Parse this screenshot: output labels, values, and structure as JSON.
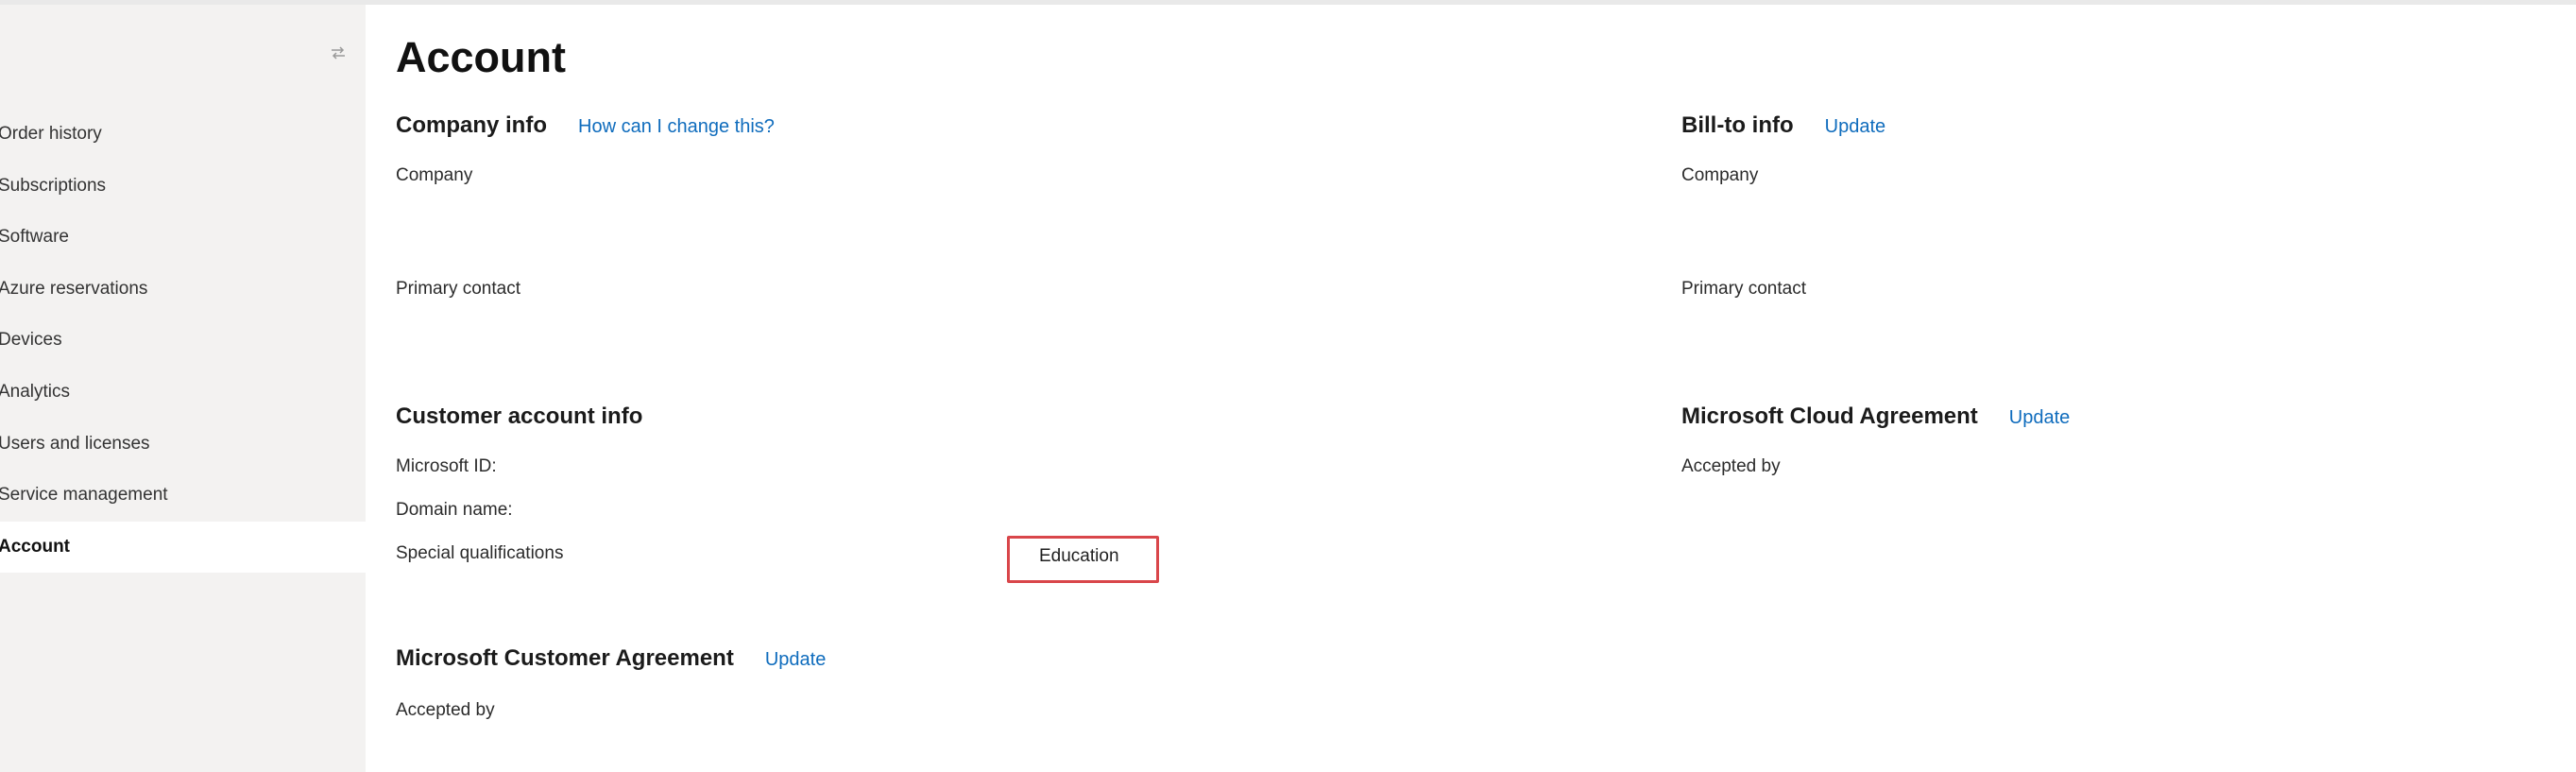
{
  "sidebar": {
    "collapse_icon": "collapse-arrows-icon",
    "items": [
      {
        "label": "Order history",
        "active": false
      },
      {
        "label": "Subscriptions",
        "active": false
      },
      {
        "label": "Software",
        "active": false
      },
      {
        "label": "Azure reservations",
        "active": false
      },
      {
        "label": "Devices",
        "active": false
      },
      {
        "label": "Analytics",
        "active": false
      },
      {
        "label": "Users and licenses",
        "active": false
      },
      {
        "label": "Service management",
        "active": false
      },
      {
        "label": "Account",
        "active": true
      }
    ]
  },
  "main": {
    "title": "Account",
    "company_info": {
      "title": "Company info",
      "link": "How can I change this?",
      "company_label": "Company",
      "primary_contact_label": "Primary contact"
    },
    "bill_to_info": {
      "title": "Bill-to info",
      "link": "Update",
      "company_label": "Company",
      "primary_contact_label": "Primary contact"
    },
    "customer_account_info": {
      "title": "Customer account info",
      "microsoft_id_label": "Microsoft ID:",
      "domain_name_label": "Domain name:",
      "special_qualifications_label": "Special qualifications",
      "special_qualifications_value": "Education"
    },
    "microsoft_cloud_agreement": {
      "title": "Microsoft Cloud Agreement",
      "link": "Update",
      "accepted_by_label": "Accepted by"
    },
    "microsoft_customer_agreement": {
      "title": "Microsoft Customer Agreement",
      "link": "Update",
      "accepted_by_label": "Accepted by"
    }
  },
  "colors": {
    "link": "#0f6cbd",
    "highlight_box": "#d9464a",
    "sidebar_bg": "#f3f2f1"
  }
}
